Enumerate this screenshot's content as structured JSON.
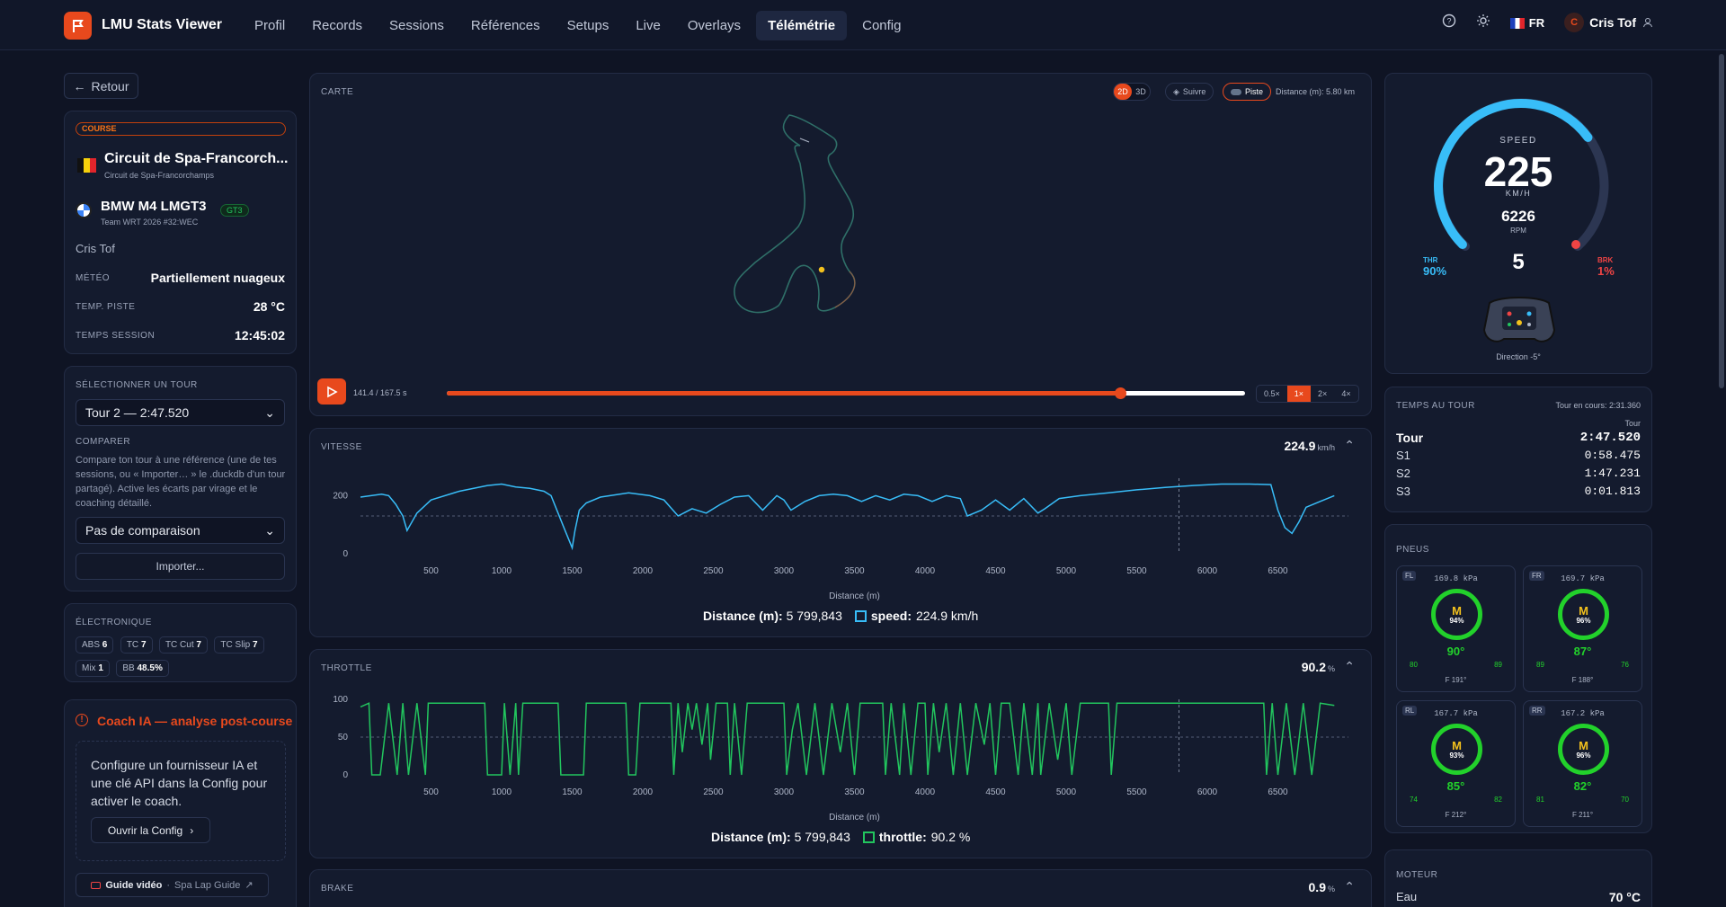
{
  "app": {
    "title": "LMU Stats Viewer"
  },
  "nav": [
    {
      "label": "Profil"
    },
    {
      "label": "Records"
    },
    {
      "label": "Sessions"
    },
    {
      "label": "Références"
    },
    {
      "label": "Setups"
    },
    {
      "label": "Live"
    },
    {
      "label": "Overlays"
    },
    {
      "label": "Télémétrie",
      "active": true
    },
    {
      "label": "Config"
    }
  ],
  "topright": {
    "lang": "FR",
    "user": "Cris Tof",
    "avatar_initial": "C"
  },
  "back": "Retour",
  "session": {
    "badge": "COURSE",
    "track": "Circuit de Spa-Francorch...",
    "track_sub": "Circuit de Spa-Francorchamps",
    "car": "BMW M4 LMGT3",
    "class": "GT3",
    "team": "Team WRT 2026 #32:WEC",
    "driver": "Cris Tof",
    "rows": [
      {
        "k": "MÉTÉO",
        "v": "Partiellement nuageux"
      },
      {
        "k": "TEMP. PISTE",
        "v": "28 °C"
      },
      {
        "k": "TEMPS SESSION",
        "v": "12:45:02"
      }
    ]
  },
  "lap": {
    "label": "SÉLECTIONNER UN TOUR",
    "selected": "Tour 2 — 2:47.520",
    "compare_label": "COMPARER",
    "compare_help": "Compare ton tour à une référence (une de tes sessions, ou « Importer… » le .duckdb d'un tour partagé). Active les écarts par virage et le coaching détaillé.",
    "compare_selected": "Pas de comparaison",
    "import": "Importer..."
  },
  "electronics": {
    "label": "ÉLECTRONIQUE",
    "chips": [
      {
        "k": "ABS",
        "v": "6"
      },
      {
        "k": "TC",
        "v": "7"
      },
      {
        "k": "TC Cut",
        "v": "7"
      },
      {
        "k": "TC Slip",
        "v": "7"
      },
      {
        "k": "Mix",
        "v": "1"
      },
      {
        "k": "BB",
        "v": "48.5%"
      }
    ]
  },
  "coach": {
    "title": "Coach IA — analyse post-course",
    "body": "Configure un fournisseur IA et une clé API dans la Config pour activer le coach.",
    "button": "Ouvrir la Config",
    "video_label": "Guide vidéo",
    "video_link": "Spa Lap Guide"
  },
  "map": {
    "label": "CARTE",
    "b2d": "2D",
    "b3d": "3D",
    "follow": "Suivre",
    "track": "Piste",
    "distance": "Distance (m): 5.80 km",
    "time": "141.4 / 167.5 s",
    "progress": 0.844,
    "speeds": [
      "0.5×",
      "1×",
      "2×",
      "4×"
    ],
    "active_speed": "1×"
  },
  "speed_chart": {
    "label": "VITESSE",
    "value": "224.9",
    "unit": "km/h",
    "xlabel": "Distance (m)",
    "cursor_label": "Distance (m):",
    "cursor_value": "5 799,843",
    "series_label": "speed:",
    "series_value": "224.9 km/h"
  },
  "throttle_chart": {
    "label": "THROTTLE",
    "value": "90.2",
    "unit": "%",
    "xlabel": "Distance (m)",
    "cursor_label": "Distance (m):",
    "cursor_value": "5 799,843",
    "series_label": "throttle:",
    "series_value": "90.2 %"
  },
  "brake_chart": {
    "label": "BRAKE",
    "value": "0.9",
    "unit": "%"
  },
  "chart_data": [
    {
      "type": "line",
      "title": "VITESSE",
      "xlabel": "Distance (m)",
      "ylabel": "",
      "xlim": [
        0,
        7000
      ],
      "ylim": [
        0,
        260
      ],
      "x_ticks": [
        500,
        1000,
        1500,
        2000,
        2500,
        3000,
        3500,
        4000,
        4500,
        5000,
        5500,
        6000,
        6500
      ],
      "y_ticks": [
        0,
        200
      ],
      "series": [
        {
          "name": "speed",
          "x": [
            0,
            150,
            200,
            250,
            300,
            330,
            400,
            500,
            700,
            900,
            1000,
            1100,
            1200,
            1300,
            1350,
            1400,
            1450,
            1500,
            1520,
            1550,
            1600,
            1700,
            1900,
            2050,
            2150,
            2250,
            2350,
            2450,
            2550,
            2650,
            2750,
            2850,
            2950,
            3000,
            3050,
            3150,
            3250,
            3350,
            3450,
            3550,
            3650,
            3750,
            3850,
            3950,
            4050,
            4150,
            4250,
            4300,
            4400,
            4500,
            4600,
            4700,
            4800,
            4850,
            4950,
            5100,
            5300,
            5500,
            5700,
            5900,
            6100,
            6300,
            6450,
            6500,
            6550,
            6600,
            6650,
            6700,
            6800,
            6900
          ],
          "y": [
            195,
            205,
            200,
            170,
            130,
            80,
            140,
            185,
            215,
            235,
            240,
            230,
            225,
            215,
            200,
            140,
            80,
            20,
            80,
            150,
            175,
            195,
            210,
            200,
            185,
            130,
            155,
            140,
            170,
            195,
            200,
            150,
            200,
            185,
            150,
            180,
            200,
            205,
            200,
            180,
            200,
            185,
            205,
            200,
            180,
            200,
            190,
            130,
            150,
            185,
            150,
            190,
            140,
            155,
            190,
            200,
            210,
            220,
            228,
            235,
            240,
            240,
            238,
            150,
            90,
            70,
            110,
            160,
            180,
            200
          ]
        }
      ]
    },
    {
      "type": "line",
      "title": "THROTTLE",
      "xlabel": "Distance (m)",
      "ylabel": "",
      "xlim": [
        0,
        7000
      ],
      "ylim": [
        0,
        100
      ],
      "x_ticks": [
        500,
        1000,
        1500,
        2000,
        2500,
        3000,
        3500,
        4000,
        4500,
        5000,
        5500,
        6000,
        6500
      ],
      "y_ticks": [
        0,
        50,
        100
      ],
      "series": [
        {
          "name": "throttle",
          "x": [
            0,
            60,
            80,
            140,
            200,
            260,
            300,
            340,
            400,
            460,
            480,
            520,
            600,
            880,
            900,
            1000,
            1020,
            1060,
            1100,
            1120,
            1150,
            1400,
            1420,
            1450,
            1550,
            1580,
            1600,
            1620,
            1880,
            1900,
            1950,
            1980,
            2200,
            2220,
            2250,
            2280,
            2320,
            2350,
            2380,
            2420,
            2460,
            2480,
            2520,
            2600,
            2620,
            2650,
            2700,
            2740,
            2800,
            3000,
            3020,
            3060,
            3100,
            3160,
            3220,
            3280,
            3340,
            3400,
            3450,
            3500,
            3540,
            3600,
            3700,
            3720,
            3760,
            3820,
            3850,
            3900,
            3950,
            4000,
            4020,
            4060,
            4100,
            4150,
            4200,
            4250,
            4300,
            4360,
            4420,
            4460,
            4500,
            4540,
            4600,
            4660,
            4700,
            4760,
            4800,
            4820,
            4880,
            4940,
            5000,
            5040,
            5100,
            5300,
            5320,
            5360,
            5400,
            6400,
            6420,
            6460,
            6500,
            6560,
            6620,
            6680,
            6740,
            6800,
            6900
          ],
          "y": [
            90,
            95,
            0,
            0,
            95,
            0,
            95,
            0,
            95,
            0,
            95,
            95,
            95,
            95,
            0,
            0,
            95,
            0,
            95,
            0,
            95,
            95,
            0,
            0,
            0,
            0,
            95,
            95,
            95,
            0,
            0,
            95,
            95,
            0,
            95,
            30,
            95,
            60,
            95,
            40,
            95,
            20,
            95,
            95,
            0,
            95,
            0,
            95,
            95,
            95,
            0,
            60,
            95,
            0,
            95,
            0,
            95,
            30,
            95,
            0,
            95,
            95,
            95,
            0,
            95,
            0,
            95,
            0,
            95,
            95,
            0,
            95,
            30,
            95,
            0,
            95,
            0,
            95,
            40,
            95,
            0,
            95,
            95,
            0,
            95,
            0,
            95,
            0,
            95,
            20,
            95,
            0,
            95,
            95,
            0,
            95,
            95,
            95,
            0,
            95,
            0,
            95,
            0,
            95,
            0,
            95,
            92
          ]
        }
      ]
    }
  ],
  "gauge": {
    "label": "SPEED",
    "speed": "225",
    "unit": "KM/H",
    "rpm": "6226",
    "rpm_label": "RPM",
    "gear": "5",
    "thr_label": "THR",
    "thr": "90%",
    "brk_label": "BRK",
    "brk": "1%",
    "direction": "Direction -5°",
    "speed_fraction": 0.7
  },
  "laptimes": {
    "label": "TEMPS AU TOUR",
    "current": "Tour en cours: 2:31.360",
    "col": "Tour",
    "rows": [
      {
        "k": "Tour",
        "v": "2:47.520"
      },
      {
        "k": "S1",
        "v": "0:58.475"
      },
      {
        "k": "S2",
        "v": "1:47.231"
      },
      {
        "k": "S3",
        "v": "0:01.813"
      }
    ]
  },
  "tyres": {
    "label": "PNEUS",
    "items": [
      {
        "pos": "FL",
        "kpa": "169.8 kPa",
        "compound": "M",
        "wear": "94%",
        "temp": "90°",
        "l": "80",
        "r": "89",
        "f": "F 191°"
      },
      {
        "pos": "FR",
        "kpa": "169.7 kPa",
        "compound": "M",
        "wear": "96%",
        "temp": "87°",
        "l": "89",
        "r": "76",
        "f": "F 188°"
      },
      {
        "pos": "RL",
        "kpa": "167.7 kPa",
        "compound": "M",
        "wear": "93%",
        "temp": "85°",
        "l": "74",
        "r": "82",
        "f": "F 212°"
      },
      {
        "pos": "RR",
        "kpa": "167.2 kPa",
        "compound": "M",
        "wear": "96%",
        "temp": "82°",
        "l": "81",
        "r": "70",
        "f": "F 211°"
      }
    ]
  },
  "engine": {
    "label": "MOTEUR",
    "rows": [
      {
        "k": "Eau",
        "v": "70 °C"
      }
    ]
  },
  "colors": {
    "accent": "#e8491d",
    "speed": "#38bdf8",
    "throttle": "#22c55e",
    "brake": "#ef4444"
  }
}
